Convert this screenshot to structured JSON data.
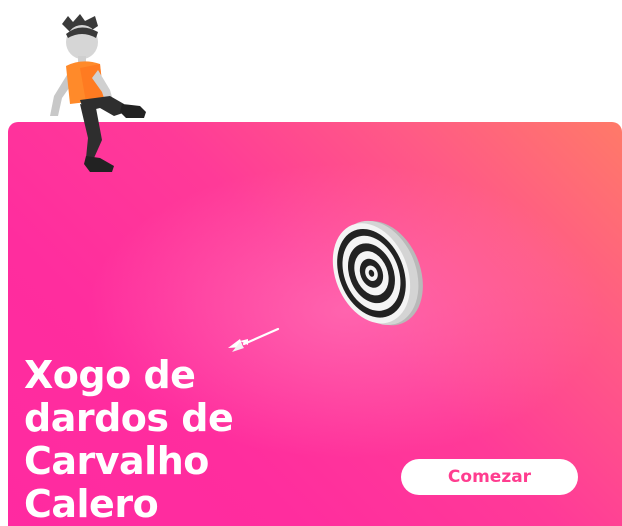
{
  "hero": {
    "title": "Xogo de dardos de Carvalho Calero",
    "start_label": "Comezar"
  },
  "illustration": {
    "character_icon": "boy-sitting-icon",
    "target_icon": "dartboard-icon",
    "dart_icon": "dart-icon"
  },
  "colors": {
    "card_gradient_start": "#ff7a68",
    "card_gradient_end": "#ff2aa1",
    "button_text": "#ff3d8f",
    "title_text": "#ffffff"
  }
}
